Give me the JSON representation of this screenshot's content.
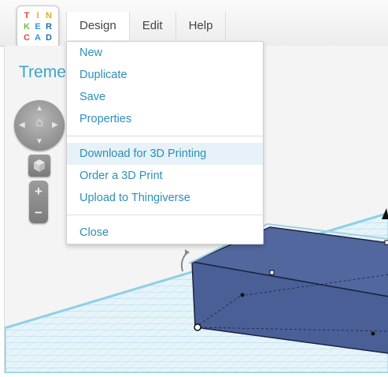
{
  "logo": {
    "letters": [
      "T",
      "I",
      "N",
      "K",
      "E",
      "R",
      "C",
      "A",
      "D"
    ],
    "colors": [
      "#e8463c",
      "#f4a13a",
      "#f3d33f",
      "#6cbf4a",
      "#2d9ad8",
      "#1c6fb0",
      "#e8463c",
      "#2d9ad8",
      "#1c6fb0"
    ]
  },
  "menubar": {
    "design": "Design",
    "edit": "Edit",
    "help": "Help"
  },
  "design_title": "Treme",
  "dropdown": {
    "groups": [
      [
        "New",
        "Duplicate",
        "Save",
        "Properties"
      ],
      [
        "Download for 3D Printing",
        "Order a 3D Print",
        "Upload to Thingiverse"
      ],
      [
        "Close"
      ]
    ],
    "highlighted": "Download for 3D Printing"
  },
  "nav": {
    "home_icon": "home-icon",
    "zoom_in": "+",
    "zoom_out": "−"
  },
  "colors": {
    "accent": "#3aa6c9",
    "shape": "#4a5f96",
    "grid": "#9fd3e6"
  }
}
